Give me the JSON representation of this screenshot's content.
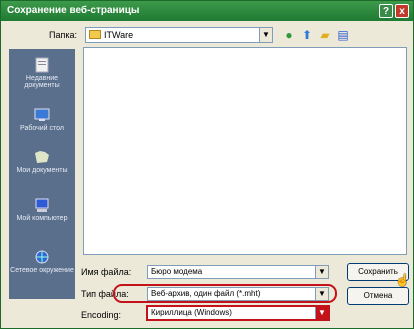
{
  "window": {
    "title": "Сохранение веб-страницы",
    "help_btn": "?",
    "close_btn": "x"
  },
  "toolbar": {
    "folder_label": "Папка:",
    "folder_value": "ITWare",
    "back_icon": "back-arrow-icon",
    "up_icon": "up-folder-icon",
    "new_folder_icon": "new-folder-icon",
    "views_icon": "views-menu-icon"
  },
  "places": [
    {
      "label": "Недавние документы",
      "icon": "recent-documents-icon"
    },
    {
      "label": "Рабочий стол",
      "icon": "desktop-icon"
    },
    {
      "label": "Мои документы",
      "icon": "my-documents-icon"
    },
    {
      "label": "Мой компьютер",
      "icon": "my-computer-icon"
    },
    {
      "label": "Сетевое окружение",
      "icon": "network-places-icon"
    }
  ],
  "fields": {
    "filename_label": "Имя файла:",
    "filename_value": "Бюро модема",
    "filetype_label": "Тип файла:",
    "filetype_value": "Веб-архив, один файл (*.mht)",
    "encoding_label": "Encoding:",
    "encoding_value": "Кириллица (Windows)"
  },
  "buttons": {
    "save": "Сохранить",
    "cancel": "Отмена"
  },
  "colors": {
    "titlebar": "#2a8a3c",
    "highlight": "#c4121a",
    "places_bar": "#5a6f8c"
  }
}
